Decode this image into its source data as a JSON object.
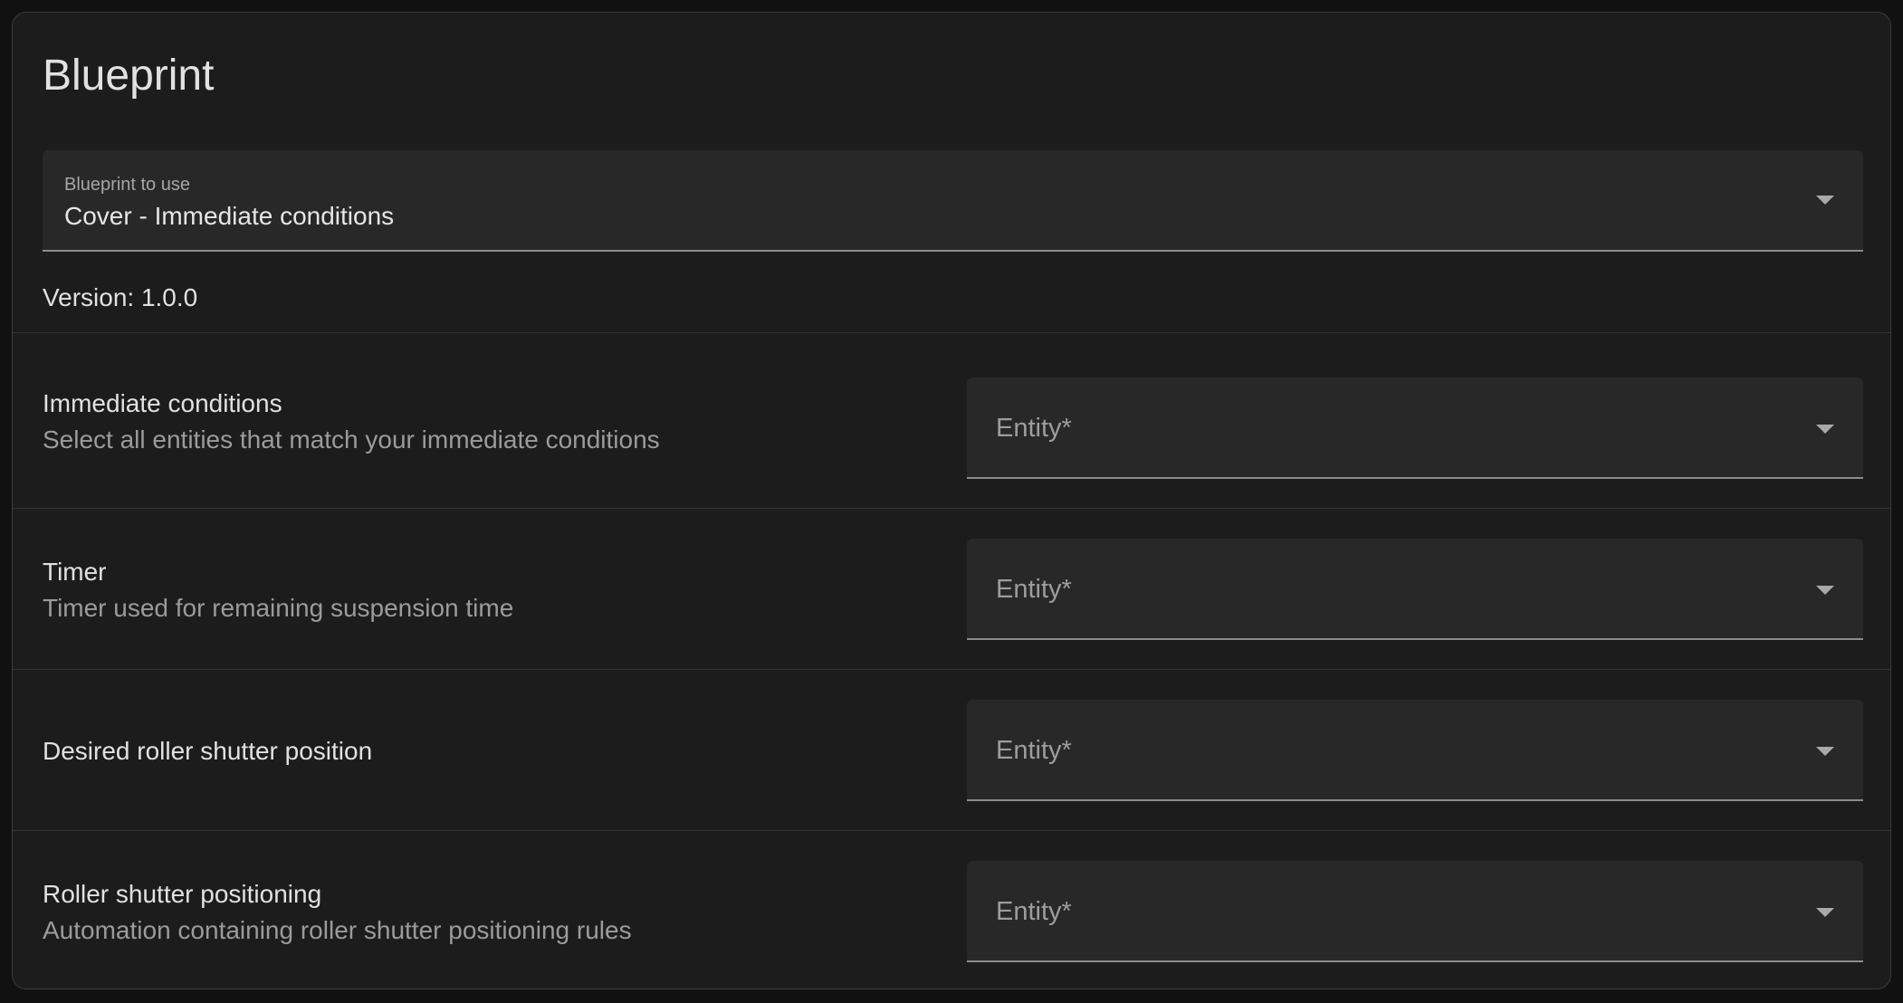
{
  "section": {
    "title": "Blueprint"
  },
  "blueprint_select": {
    "label": "Blueprint to use",
    "value": "Cover - Immediate conditions"
  },
  "version_text": "Version: 1.0.0",
  "rows": [
    {
      "title": "Immediate conditions",
      "description": "Select all entities that match your immediate conditions",
      "placeholder": "Entity*"
    },
    {
      "title": "Timer",
      "description": "Timer used for remaining suspension time",
      "placeholder": "Entity*"
    },
    {
      "title": "Desired roller shutter position",
      "description": "",
      "placeholder": "Entity*"
    },
    {
      "title": "Roller shutter positioning",
      "description": "Automation containing roller shutter positioning rules",
      "placeholder": "Entity*"
    }
  ],
  "icons": {
    "dropdown": "chevron-down-icon"
  },
  "colors": {
    "card_background": "#1c1c1c",
    "field_background": "#282828",
    "primary_text": "#e1e1e1",
    "secondary_text": "#9b9b9b"
  }
}
